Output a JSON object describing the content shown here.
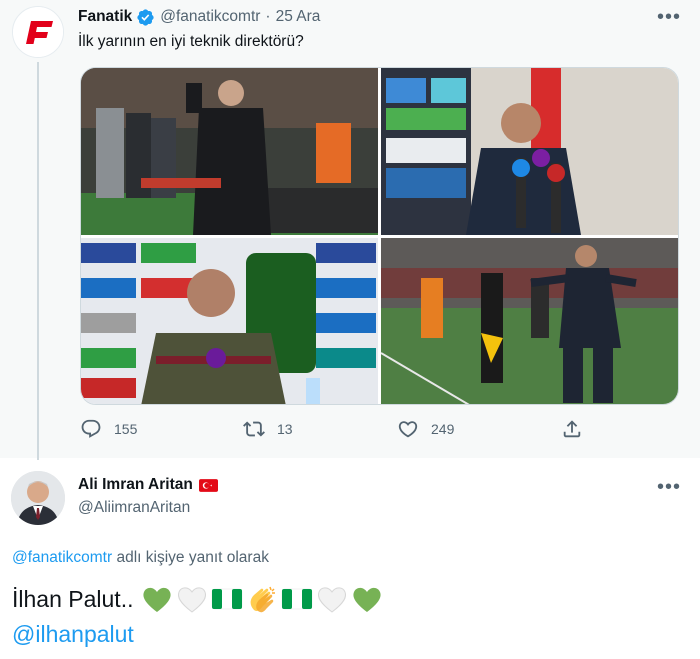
{
  "original_tweet": {
    "author_name": "Fanatik",
    "author_handle": "@fanatikcomtr",
    "separator": "·",
    "date": "25 Ara",
    "verified": true,
    "text": "İlk yarının en iyi teknik direktörü?",
    "avatar_logo_letter": "F",
    "brand_color": "#e2001a",
    "more_label": "•••",
    "media": [
      {
        "icon": "photo-coach-sideline"
      },
      {
        "icon": "photo-coach-press-conference"
      },
      {
        "icon": "photo-coach-press-sponsor-wall"
      },
      {
        "icon": "photo-coach-gesturing-pitch"
      }
    ],
    "stats": {
      "replies": "155",
      "retweets": "13",
      "likes": "249"
    }
  },
  "reply_tweet": {
    "author_name": "Ali Imran Aritan",
    "author_handle": "@AliimranAritan",
    "flag": "turkey-flag",
    "more_label": "•••",
    "context_mention": "@fanatikcomtr",
    "context_suffix": " adlı kişiye yanıt olarak",
    "text": "İlhan Palut..",
    "emojis": [
      "green-heart",
      "white-heart",
      "nigeria-flag",
      "clapping-hands",
      "nigeria-flag",
      "white-heart",
      "green-heart"
    ],
    "mention": "@ilhanpalut"
  },
  "colors": {
    "link": "#1d9bf0",
    "secondary_text": "#536471",
    "verified": "#1d9bf0",
    "top_background": "#f7f9f9"
  }
}
